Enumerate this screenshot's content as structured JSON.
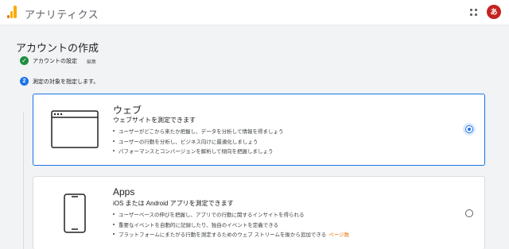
{
  "header": {
    "app_title": "アナリティクス",
    "avatar_text": "あ"
  },
  "page": {
    "title": "アカウントの作成"
  },
  "steps": [
    {
      "number": "✓",
      "label": "アカウントの設定",
      "action": "編集",
      "state": "done"
    },
    {
      "number": "2",
      "label": "測定の対象を指定します。",
      "state": "active"
    }
  ],
  "options": [
    {
      "title": "ウェブ",
      "subtitle": "ウェブサイトを測定できます",
      "bullets": [
        "ユーザーがどこから来たか把握し、データを分析して情報を得ましょう",
        "ユーザーの行動を分析し、ビジネス向けに最適化しましょう",
        "パフォーマンスとコンバージョンを解析して傾向を把握しましょう"
      ],
      "icon": "browser-window-icon",
      "selected": true
    },
    {
      "title": "Apps",
      "subtitle": "iOS または Android アプリを測定できます",
      "bullets": [
        "ユーザーベースの伸びを把握し、アプリでの行動に関するインサイトを得られる",
        "重要なイベントを自動的に記録したり、独自のイベントを定義できる",
        "プラットフォームにまたがる行動を測定するためのウェブ ストリームを後から追加できる"
      ],
      "learn_more": "ページ数",
      "icon": "smartphone-icon",
      "selected": false
    }
  ],
  "colors": {
    "accent": "#1a73e8",
    "success": "#1e8e3e",
    "logo_orange": "#f9ab00",
    "link_orange": "#e37400"
  }
}
